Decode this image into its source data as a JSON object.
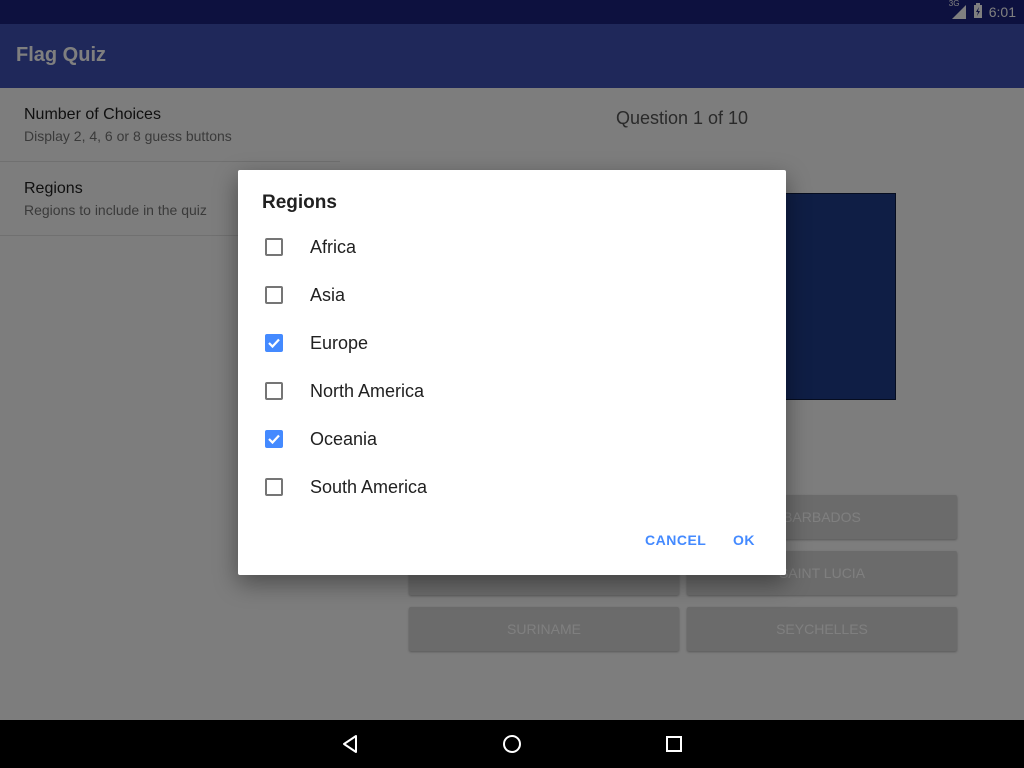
{
  "status_bar": {
    "network_type": "3G",
    "time": "6:01"
  },
  "app_bar": {
    "title": "Flag Quiz"
  },
  "settings": {
    "items": [
      {
        "title": "Number of Choices",
        "summary": "Display 2, 4, 6 or 8 guess buttons"
      },
      {
        "title": "Regions",
        "summary": "Regions to include in the quiz"
      }
    ]
  },
  "quiz": {
    "question": "Question 1 of 10",
    "flag_color": "#1e3c8a",
    "guesses": [
      "",
      "BARBADOS",
      "",
      "SAINT LUCIA",
      "SURINAME",
      "SEYCHELLES"
    ]
  },
  "dialog": {
    "title": "Regions",
    "options": [
      {
        "label": "Africa",
        "checked": false
      },
      {
        "label": "Asia",
        "checked": false
      },
      {
        "label": "Europe",
        "checked": true
      },
      {
        "label": "North America",
        "checked": false
      },
      {
        "label": "Oceania",
        "checked": true
      },
      {
        "label": "South America",
        "checked": false
      }
    ],
    "cancel_label": "CANCEL",
    "ok_label": "OK"
  },
  "nav_bar": {
    "icons": [
      "back-icon",
      "home-icon",
      "recents-icon"
    ]
  },
  "colors": {
    "status_bar": "#1a237e",
    "app_bar": "#3f51b5",
    "accent": "#448aff"
  }
}
